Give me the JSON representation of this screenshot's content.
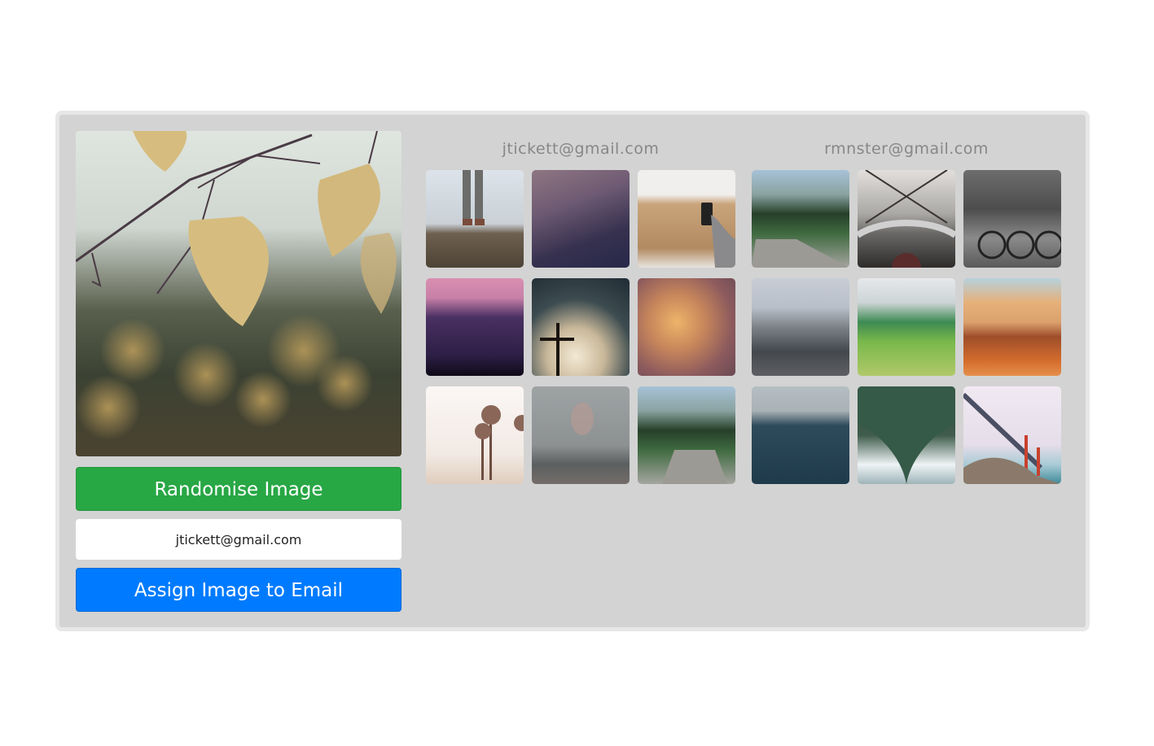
{
  "main_image": {
    "icon": "image-icon",
    "description": "Autumn birch leaves hanging from branches with blurred bokeh background"
  },
  "buttons": {
    "randomise_label": "Randomise Image",
    "assign_label": "Assign Image to Email"
  },
  "email_input": {
    "value": "jtickett@gmail.com"
  },
  "colors": {
    "randomise": "#28a745",
    "assign": "#007bff",
    "panel_bg": "#d3d3d3",
    "panel_border": "#e7e7e7",
    "email_heading": "#878787"
  },
  "users": [
    {
      "email": "jtickett@gmail.com",
      "images": [
        {
          "description": "Person standing on rocky cliff in fog"
        },
        {
          "description": "Purple starry night sky with streaking clouds"
        },
        {
          "description": "Hand holding phone over wooden table"
        },
        {
          "description": "Pink sunset over dark purple cloud with plane"
        },
        {
          "description": "Cross silhouette against cloudy sky"
        },
        {
          "description": "Orange stormy clouds with bird"
        },
        {
          "description": "Palm trees on hazy beach"
        },
        {
          "description": "Woman behind rainy window"
        },
        {
          "description": "Wooden pier on mountain lake"
        }
      ]
    },
    {
      "email": "rmnster@gmail.com",
      "images": [
        {
          "description": "Wooden pier on mountain lake"
        },
        {
          "description": "Observation binocular viewer over city"
        },
        {
          "description": "Cyclists in motion blur, black and white"
        },
        {
          "description": "Snowy mountain peak with clouds"
        },
        {
          "description": "Green grassy hills with trail"
        },
        {
          "description": "Orange sunset over mountains and clouds"
        },
        {
          "description": "Ocean waves with distant ship"
        },
        {
          "description": "Underside of green bridge"
        },
        {
          "description": "Golden Gate Bridge against pale sky"
        }
      ]
    }
  ]
}
